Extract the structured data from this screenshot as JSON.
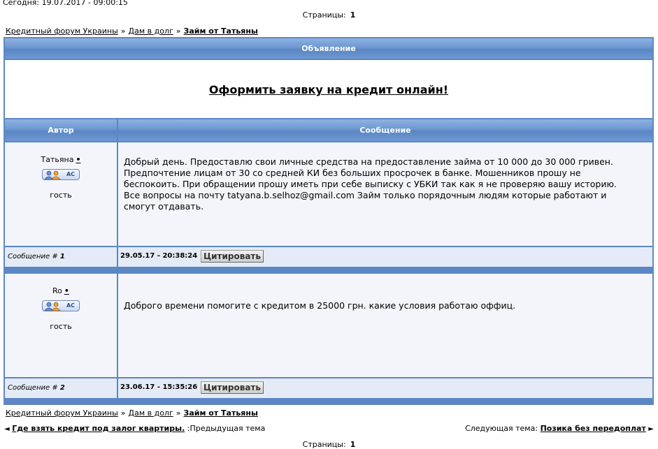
{
  "today": "Сегодня: 19.07.2017 - 09:00:15",
  "pagination": {
    "label": "Страницы:",
    "current": "1"
  },
  "breadcrumb": {
    "forum": "Кредитный форум Украины",
    "separator": "»",
    "section": "Дам в долг",
    "topic": "Займ от Татьяны"
  },
  "announcement": {
    "header": "Объявление",
    "link": "Оформить заявку на кредит онлайн!"
  },
  "table_headers": {
    "author": "Автор",
    "message": "Сообщение"
  },
  "posts": [
    {
      "author": "Татьяна",
      "online_marker": "•",
      "badge": "AC",
      "role": "гость",
      "text": "Добрый день. Предоставлю свои личные средства на предоставление займа от 10 000 до 30 000 гривен. Предпочтение лицам от 30 со средней КИ без больших просрочек в банке. Мошенников прошу не беспокоить. При обращении прошу иметь при себе выписку с УБКИ так как я не проверяю вашу историю. Все вопросы на почту tatyana.b.selhoz@gmail.com Займ только порядочным людям которые работают и смогут отдавать.",
      "number_label": "Сообщение #",
      "number": "1",
      "date": "29.05.17 - 20:38:24",
      "quote_label": "Цитировать"
    },
    {
      "author": "Ro",
      "online_marker": "•",
      "badge": "AC",
      "role": "гость",
      "text": "Доброго времени помогите с кредитом в 25000 грн. какие условия работаю оффиц.",
      "number_label": "Сообщение #",
      "number": "2",
      "date": "23.06.17 - 15:35:26",
      "quote_label": "Цитировать"
    }
  ],
  "topic_nav": {
    "prev_arrow": "◄",
    "prev_link": "Где взять кредит под залог квартиры.",
    "prev_label": ":Предыдущая тема",
    "next_label": "Следующая тема:",
    "next_link": "Позика без передоплат",
    "next_arrow": "►"
  },
  "colors": {
    "header_blue": "#6d97d1",
    "frame_blue": "#5b87c5",
    "cell_bg": "#f3f5fa",
    "footer_bg": "#e4ebf6"
  }
}
